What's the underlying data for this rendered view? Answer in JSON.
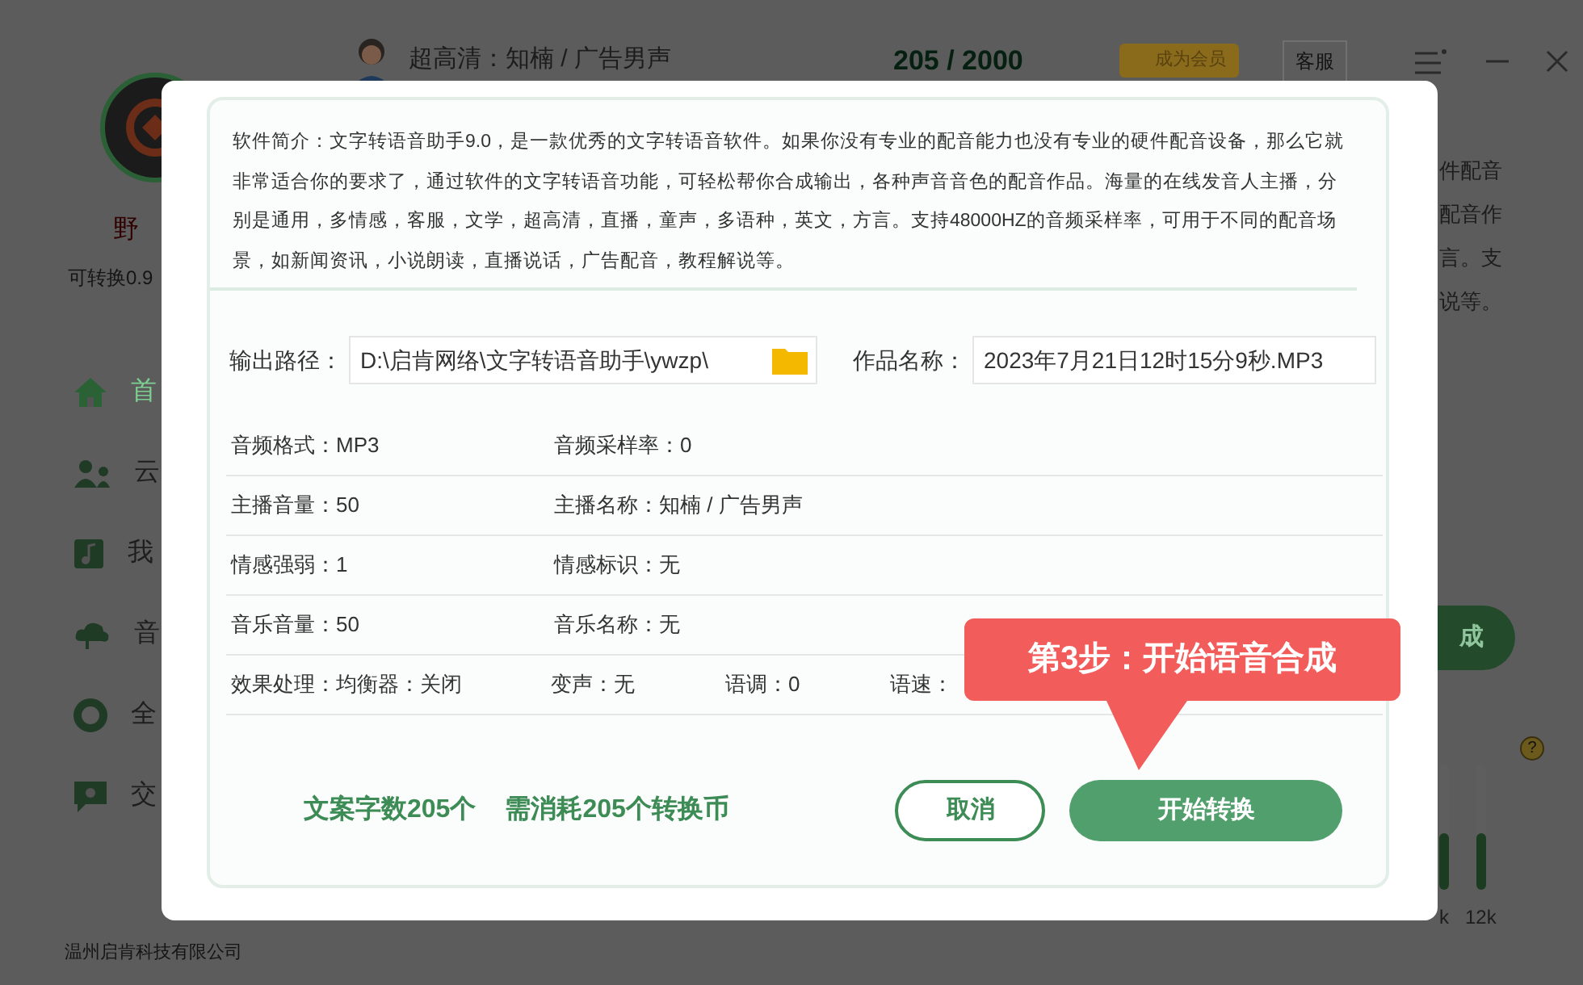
{
  "app": {
    "sidebar": {
      "user_name": "野",
      "credit": "可转换0.9",
      "nav": [
        {
          "label": "首",
          "selected": true
        },
        {
          "label": "云",
          "selected": false
        },
        {
          "label": "我",
          "selected": false
        },
        {
          "label": "音",
          "selected": false
        },
        {
          "label": "全",
          "selected": false
        },
        {
          "label": "交",
          "selected": false
        }
      ],
      "footer": "温州启肯科技有限公司"
    },
    "header": {
      "voice": "超高清：知楠 / 广告男声",
      "count": "205 / 2000",
      "vip": "成为会员",
      "service": "客服"
    },
    "right_panel": {
      "text_lines": [
        "件配音",
        "配音作",
        "言。支",
        "说等。"
      ],
      "button": "成",
      "help": "?",
      "sliders": [
        {
          "label": "k",
          "level": 0.45
        },
        {
          "label": "12k",
          "level": 0.45
        }
      ]
    }
  },
  "dialog": {
    "description": "软件简介：文字转语音助手9.0，是一款优秀的文字转语音软件。如果你没有专业的配音能力也没有专业的硬件配音设备，那么它就非常适合你的要求了，通过软件的文字转语音功能，可轻松帮你合成输出，各种声音音色的配音作品。海量的在线发音人主播，分别是通用，多情感，客服，文学，超高清，直播，童声，多语种，英文，方言。支持48000HZ的音频采样率，可用于不同的配音场景，如新闻资讯，小说朗读，直播说话，广告配音，教程解说等。",
    "output_path": {
      "label": "输出路径：",
      "value": "D:\\启肯网络\\文字转语音助手\\ywzp\\"
    },
    "work_name": {
      "label": "作品名称：",
      "value": "2023年7月21日12时15分9秒.MP3"
    },
    "info_rows": [
      [
        {
          "label": "音频格式：",
          "value": "MP3"
        },
        {
          "label": "音频采样率：",
          "value": "0"
        }
      ],
      [
        {
          "label": "主播音量：",
          "value": "50"
        },
        {
          "label": "主播名称：",
          "value": "知楠 / 广告男声"
        }
      ],
      [
        {
          "label": "情感强弱：",
          "value": "1"
        },
        {
          "label": "情感标识：",
          "value": "无"
        }
      ],
      [
        {
          "label": "音乐音量：",
          "value": "50"
        },
        {
          "label": "音乐名称：",
          "value": "无"
        }
      ],
      [
        {
          "label": "效果处理：",
          "value": "均衡器：关闭"
        },
        {
          "label": "变声：",
          "value": "无"
        },
        {
          "label": "语调：",
          "value": "0"
        },
        {
          "label": "语速："
        }
      ]
    ],
    "summary": [
      "文案字数205个",
      "需消耗205个转换币"
    ],
    "buttons": [
      {
        "label": "取消",
        "kind": "secondary"
      },
      {
        "label": "开始转换",
        "kind": "primary"
      }
    ]
  },
  "callout": {
    "text": "第3步：开始语音合成"
  }
}
